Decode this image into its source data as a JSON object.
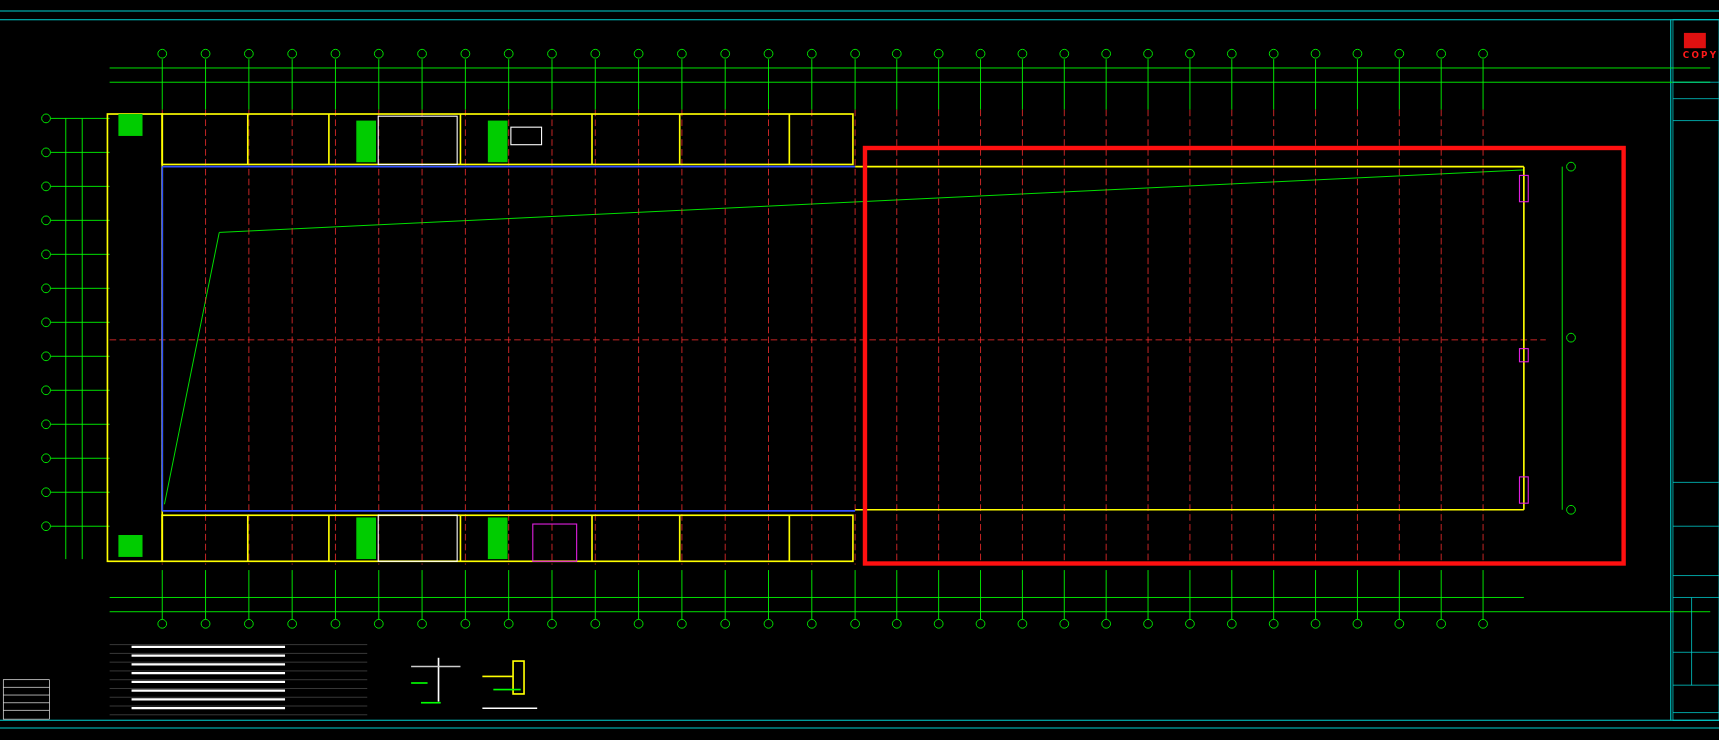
{
  "title_block": {
    "stamp": "COPY"
  }
}
